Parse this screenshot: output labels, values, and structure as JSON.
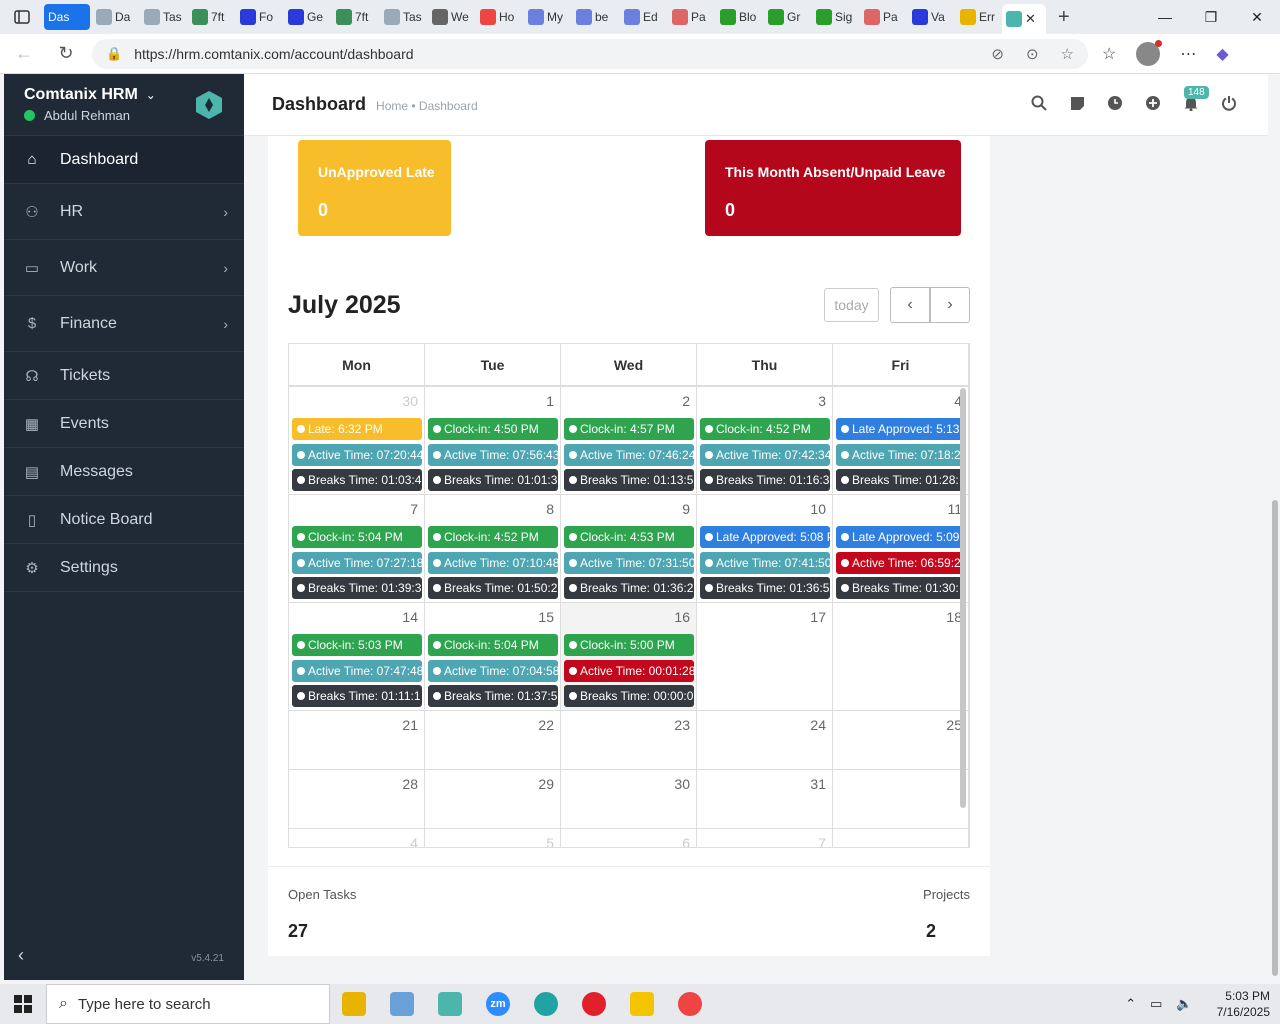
{
  "browser": {
    "tabs": [
      {
        "label": "Das",
        "color": "#1a73e8"
      },
      {
        "label": "Da",
        "color": "#9ab"
      },
      {
        "label": "Tas",
        "color": "#9ab"
      },
      {
        "label": "7ft",
        "color": "#3a8f5a"
      },
      {
        "label": "Fo",
        "color": "#2a3ad8"
      },
      {
        "label": "Ge",
        "color": "#2a3ad8"
      },
      {
        "label": "7ft",
        "color": "#3a8f5a"
      },
      {
        "label": "Tas",
        "color": "#9ab"
      },
      {
        "label": "We",
        "color": "#666"
      },
      {
        "label": "Ho",
        "color": "#e44"
      },
      {
        "label": "My",
        "color": "#6b7fe0"
      },
      {
        "label": "be",
        "color": "#6b7fe0"
      },
      {
        "label": "Ed",
        "color": "#6b7fe0"
      },
      {
        "label": "Pa",
        "color": "#d66"
      },
      {
        "label": "Blo",
        "color": "#2a9d2a"
      },
      {
        "label": "Gr",
        "color": "#2a9d2a"
      },
      {
        "label": "Sig",
        "color": "#2a9d2a"
      },
      {
        "label": "Pa",
        "color": "#d66"
      },
      {
        "label": "Va",
        "color": "#2a3ad8"
      },
      {
        "label": "Err",
        "color": "#e8b400"
      }
    ],
    "url": "https://hrm.comtanix.com/account/dashboard"
  },
  "sidebar": {
    "brand": "Comtanix HRM",
    "user": "Abdul Rehman",
    "version": "v5.4.21",
    "items": [
      {
        "label": "Dashboard",
        "icon": "home-icon",
        "arrow": false
      },
      {
        "label": "HR",
        "icon": "users-icon",
        "arrow": true
      },
      {
        "label": "Work",
        "icon": "briefcase-icon",
        "arrow": true
      },
      {
        "label": "Finance",
        "icon": "dollar-icon",
        "arrow": true
      },
      {
        "label": "Tickets",
        "icon": "headset-icon",
        "arrow": false
      },
      {
        "label": "Events",
        "icon": "calendar-icon",
        "arrow": false
      },
      {
        "label": "Messages",
        "icon": "message-icon",
        "arrow": false
      },
      {
        "label": "Notice Board",
        "icon": "clipboard-icon",
        "arrow": false
      },
      {
        "label": "Settings",
        "icon": "gear-icon",
        "arrow": false
      }
    ]
  },
  "header": {
    "title": "Dashboard",
    "breadcrumb": "Home • Dashboard",
    "notification_count": "148"
  },
  "cards": {
    "late": {
      "title": "UnApproved Late",
      "value": "0"
    },
    "absent": {
      "title": "This Month Absent/Unpaid Leave",
      "value": "0"
    }
  },
  "calendar": {
    "title": "July 2025",
    "today_label": "today",
    "weekdays": [
      "Mon",
      "Tue",
      "Wed",
      "Thu",
      "Fri"
    ],
    "weeks": [
      {
        "days": [
          {
            "num": "30",
            "other": true,
            "events": [
              [
                "c-late",
                "Late: 6:32 PM"
              ],
              [
                "c-active",
                "Active Time: 07:20:44"
              ],
              [
                "c-break",
                "Breaks Time: 01:03:4"
              ]
            ]
          },
          {
            "num": "1",
            "events": [
              [
                "c-clock",
                "Clock-in: 4:50 PM"
              ],
              [
                "c-active",
                "Active Time: 07:56:43"
              ],
              [
                "c-break",
                "Breaks Time: 01:01:3"
              ]
            ]
          },
          {
            "num": "2",
            "events": [
              [
                "c-clock",
                "Clock-in: 4:57 PM"
              ],
              [
                "c-active",
                "Active Time: 07:46:24"
              ],
              [
                "c-break",
                "Breaks Time: 01:13:5"
              ]
            ]
          },
          {
            "num": "3",
            "events": [
              [
                "c-clock",
                "Clock-in: 4:52 PM"
              ],
              [
                "c-active",
                "Active Time: 07:42:34"
              ],
              [
                "c-break",
                "Breaks Time: 01:16:3"
              ]
            ]
          },
          {
            "num": "4",
            "events": [
              [
                "c-approved",
                "Late Approved: 5:13"
              ],
              [
                "c-active",
                "Active Time: 07:18:2"
              ],
              [
                "c-break",
                "Breaks Time: 01:28:"
              ]
            ]
          }
        ]
      },
      {
        "days": [
          {
            "num": "7",
            "events": [
              [
                "c-clock",
                "Clock-in: 5:04 PM"
              ],
              [
                "c-active",
                "Active Time: 07:27:18"
              ],
              [
                "c-break",
                "Breaks Time: 01:39:3"
              ]
            ]
          },
          {
            "num": "8",
            "events": [
              [
                "c-clock",
                "Clock-in: 4:52 PM"
              ],
              [
                "c-active",
                "Active Time: 07:10:48"
              ],
              [
                "c-break",
                "Breaks Time: 01:50:2"
              ]
            ]
          },
          {
            "num": "9",
            "events": [
              [
                "c-clock",
                "Clock-in: 4:53 PM"
              ],
              [
                "c-active",
                "Active Time: 07:31:50"
              ],
              [
                "c-break",
                "Breaks Time: 01:36:2"
              ]
            ]
          },
          {
            "num": "10",
            "events": [
              [
                "c-approved",
                "Late Approved: 5:08 P"
              ],
              [
                "c-active",
                "Active Time: 07:41:50"
              ],
              [
                "c-break",
                "Breaks Time: 01:36:5"
              ]
            ]
          },
          {
            "num": "11",
            "events": [
              [
                "c-approved",
                "Late Approved: 5:09"
              ],
              [
                "c-red",
                "Active Time: 06:59:2"
              ],
              [
                "c-break",
                "Breaks Time: 01:30:"
              ]
            ]
          }
        ]
      },
      {
        "days": [
          {
            "num": "14",
            "events": [
              [
                "c-clock",
                "Clock-in: 5:03 PM"
              ],
              [
                "c-active",
                "Active Time: 07:47:48"
              ],
              [
                "c-break",
                "Breaks Time: 01:11:1"
              ]
            ]
          },
          {
            "num": "15",
            "events": [
              [
                "c-clock",
                "Clock-in: 5:04 PM"
              ],
              [
                "c-active",
                "Active Time: 07:04:58"
              ],
              [
                "c-break",
                "Breaks Time: 01:37:5"
              ]
            ]
          },
          {
            "num": "16",
            "today": true,
            "events": [
              [
                "c-clock",
                "Clock-in: 5:00 PM"
              ],
              [
                "c-red",
                "Active Time: 00:01:28"
              ],
              [
                "c-break",
                "Breaks Time: 00:00:0"
              ]
            ]
          },
          {
            "num": "17",
            "events": []
          },
          {
            "num": "18",
            "events": []
          }
        ]
      },
      {
        "days": [
          {
            "num": "21",
            "events": []
          },
          {
            "num": "22",
            "events": []
          },
          {
            "num": "23",
            "events": []
          },
          {
            "num": "24",
            "events": []
          },
          {
            "num": "25",
            "events": []
          }
        ]
      },
      {
        "days": [
          {
            "num": "28",
            "events": []
          },
          {
            "num": "29",
            "events": []
          },
          {
            "num": "30",
            "events": []
          },
          {
            "num": "31",
            "events": []
          },
          {
            "num": "",
            "events": []
          }
        ]
      },
      {
        "days": [
          {
            "num": "4",
            "other": true,
            "events": []
          },
          {
            "num": "5",
            "other": true,
            "events": []
          },
          {
            "num": "6",
            "other": true,
            "events": []
          },
          {
            "num": "7",
            "other": true,
            "events": []
          },
          {
            "num": "",
            "events": []
          }
        ]
      }
    ]
  },
  "stats": {
    "open_tasks_label": "Open Tasks",
    "open_tasks_value": "27",
    "projects_label": "Projects",
    "projects_value": "2"
  },
  "taskbar": {
    "search_placeholder": "Type here to search",
    "time": "5:03 PM",
    "date": "7/16/2025"
  }
}
